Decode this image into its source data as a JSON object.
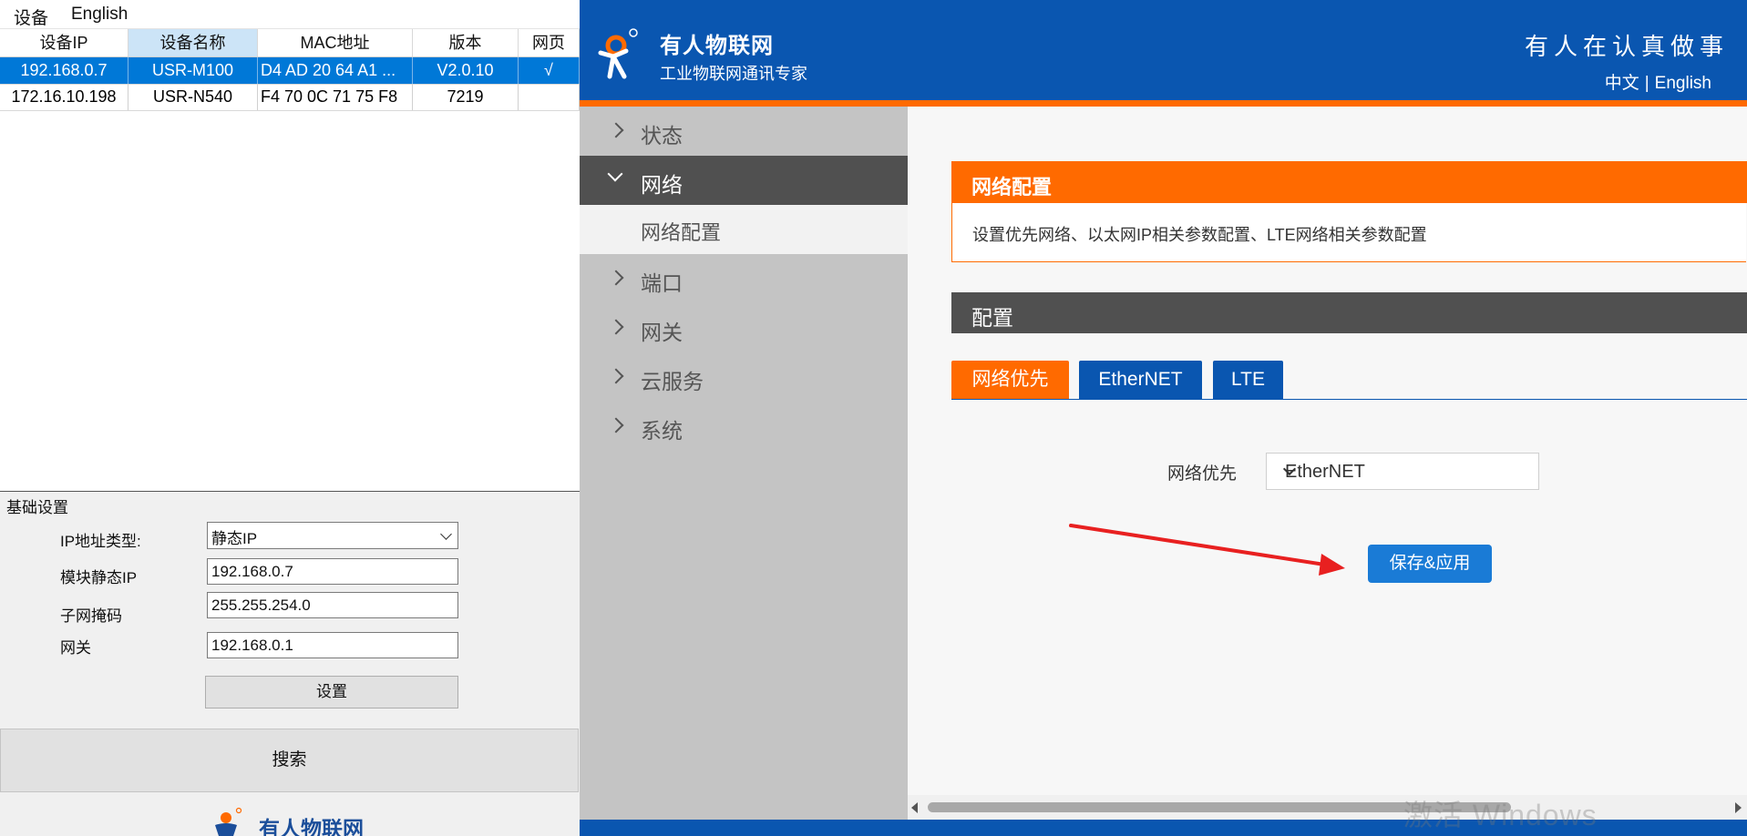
{
  "tool": {
    "menu": [
      "设备",
      "English"
    ],
    "columns": [
      "设备IP",
      "设备名称",
      "MAC地址",
      "版本",
      "网页"
    ],
    "rows": [
      {
        "ip": "192.168.0.7",
        "name": "USR-M100",
        "mac": "D4 AD 20 64 A1 ...",
        "version": "V2.0.10",
        "web": "√",
        "selected": true
      },
      {
        "ip": "172.16.10.198",
        "name": "USR-N540",
        "mac": "F4 70 0C 71 75 F8",
        "version": "7219",
        "web": "",
        "selected": false
      }
    ],
    "basic": {
      "legend": "基础设置",
      "ip_type_label": "IP地址类型:",
      "ip_type_value": "静态IP",
      "static_ip_label": "模块静态IP",
      "static_ip_value": "192.168.0.7",
      "subnet_label": "子网掩码",
      "subnet_value": "255.255.254.0",
      "gateway_label": "网关",
      "gateway_value": "192.168.0.1",
      "set_label": "设置"
    },
    "search_label": "搜索",
    "logo_text": "有人物联网"
  },
  "web": {
    "brand_name": "有人物联网",
    "brand_sub": "工业物联网通讯专家",
    "slogan": "有人在认真做事",
    "lang_cn": "中文",
    "lang_sep": "|",
    "lang_en": "English",
    "nav": [
      {
        "label": "状态"
      },
      {
        "label": "网络"
      },
      {
        "label": "网络配置"
      },
      {
        "label": "端口"
      },
      {
        "label": "网关"
      },
      {
        "label": "云服务"
      },
      {
        "label": "系统"
      }
    ],
    "section_title": "网络配置",
    "section_desc": "设置优先网络、以太网IP相关参数配置、LTE网络相关参数配置",
    "config_title": "配置",
    "tabs": [
      "网络优先",
      "EtherNET",
      "LTE"
    ],
    "priority_label": "网络优先",
    "priority_value": "EtherNET",
    "save_label": "保存&应用"
  },
  "watermark": "激活 Windows",
  "colors": {
    "brand_blue": "#0a56b0",
    "brand_orange": "#ff6a00",
    "select_blue": "#0078d7",
    "annotation_red": "#e82020"
  }
}
